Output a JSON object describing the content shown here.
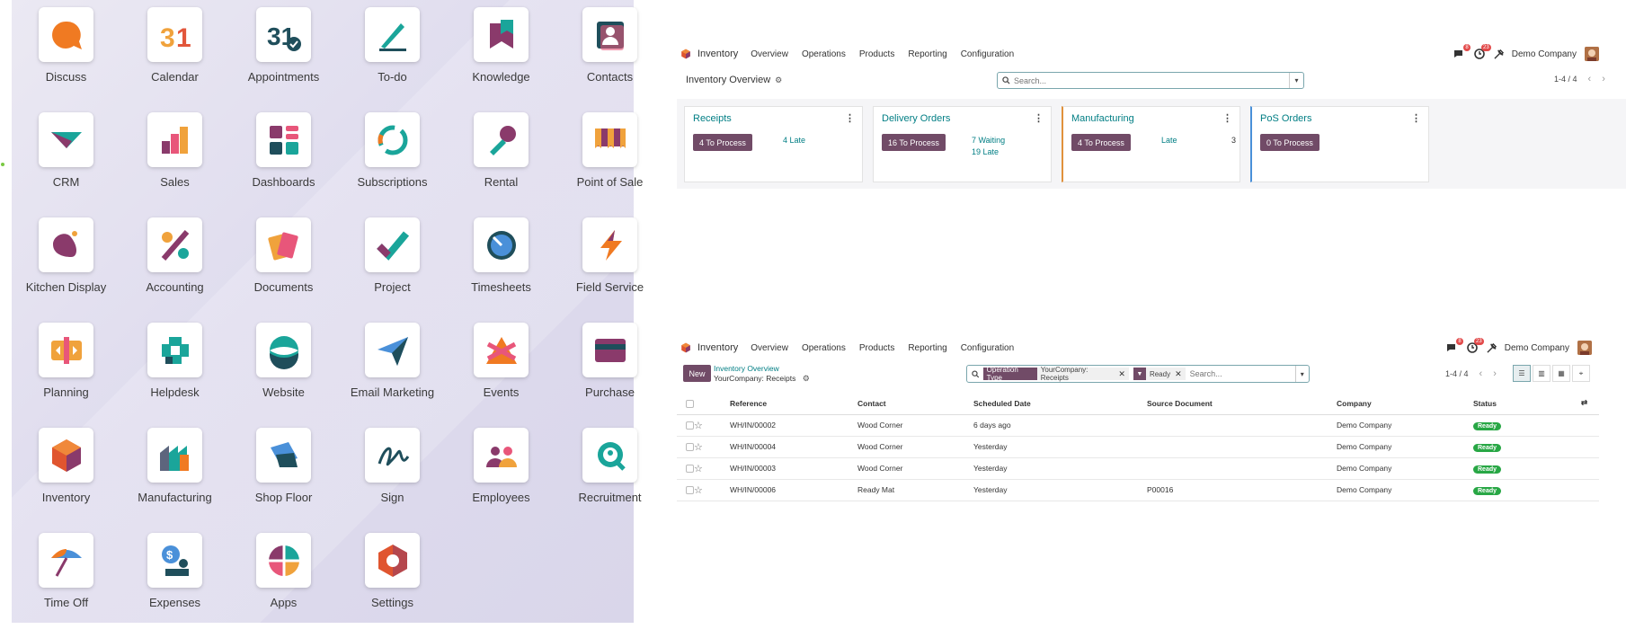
{
  "launcher": {
    "apps": [
      {
        "label": "Discuss",
        "icon": "discuss-icon"
      },
      {
        "label": "Calendar",
        "icon": "calendar-icon"
      },
      {
        "label": "Appointments",
        "icon": "appointments-icon"
      },
      {
        "label": "To-do",
        "icon": "todo-icon"
      },
      {
        "label": "Knowledge",
        "icon": "knowledge-icon"
      },
      {
        "label": "Contacts",
        "icon": "contacts-icon"
      },
      {
        "label": "CRM",
        "icon": "crm-icon"
      },
      {
        "label": "Sales",
        "icon": "sales-icon"
      },
      {
        "label": "Dashboards",
        "icon": "dashboards-icon"
      },
      {
        "label": "Subscriptions",
        "icon": "subscriptions-icon"
      },
      {
        "label": "Rental",
        "icon": "rental-icon"
      },
      {
        "label": "Point of Sale",
        "icon": "point-of-sale-icon"
      },
      {
        "label": "Kitchen Display",
        "icon": "kitchen-display-icon"
      },
      {
        "label": "Accounting",
        "icon": "accounting-icon"
      },
      {
        "label": "Documents",
        "icon": "documents-icon"
      },
      {
        "label": "Project",
        "icon": "project-icon"
      },
      {
        "label": "Timesheets",
        "icon": "timesheets-icon"
      },
      {
        "label": "Field Service",
        "icon": "field-service-icon"
      },
      {
        "label": "Planning",
        "icon": "planning-icon"
      },
      {
        "label": "Helpdesk",
        "icon": "helpdesk-icon"
      },
      {
        "label": "Website",
        "icon": "website-icon"
      },
      {
        "label": "Email Marketing",
        "icon": "email-marketing-icon"
      },
      {
        "label": "Events",
        "icon": "events-icon"
      },
      {
        "label": "Purchase",
        "icon": "purchase-icon"
      },
      {
        "label": "Inventory",
        "icon": "inventory-icon"
      },
      {
        "label": "Manufacturing",
        "icon": "manufacturing-icon"
      },
      {
        "label": "Shop Floor",
        "icon": "shop-floor-icon"
      },
      {
        "label": "Sign",
        "icon": "sign-icon"
      },
      {
        "label": "Employees",
        "icon": "employees-icon"
      },
      {
        "label": "Recruitment",
        "icon": "recruitment-icon"
      },
      {
        "label": "Time Off",
        "icon": "time-off-icon"
      },
      {
        "label": "Expenses",
        "icon": "expenses-icon"
      },
      {
        "label": "Apps",
        "icon": "apps-icon"
      },
      {
        "label": "Settings",
        "icon": "settings-icon"
      }
    ]
  },
  "topbar": {
    "app_name": "Inventory",
    "menu": [
      "Overview",
      "Operations",
      "Products",
      "Reporting",
      "Configuration"
    ],
    "messages_count": "8",
    "activities_count": "23",
    "company": "Demo Company"
  },
  "overview": {
    "title": "Inventory Overview",
    "search_placeholder": "Search...",
    "pager": "1-4 / 4",
    "cards": [
      {
        "title": "Receipts",
        "button": "4 To Process",
        "stats": [
          "4 Late"
        ],
        "accent": ""
      },
      {
        "title": "Delivery Orders",
        "button": "16 To Process",
        "stats": [
          "7 Waiting",
          "19 Late"
        ],
        "accent": ""
      },
      {
        "title": "Manufacturing",
        "button": "4 To Process",
        "stats": [
          "Late"
        ],
        "number": "3",
        "accent": "#e0913c"
      },
      {
        "title": "PoS Orders",
        "button": "0 To Process",
        "stats": [],
        "accent": "#4a90d9"
      }
    ]
  },
  "list": {
    "new_label": "New",
    "breadcrumb_parent": "Inventory Overview",
    "breadcrumb_current": "YourCompany: Receipts",
    "facets": [
      {
        "label": "Operation Type",
        "value": "YourCompany: Receipts"
      },
      {
        "label": "",
        "value": "Ready"
      }
    ],
    "search_placeholder": "Search...",
    "pager": "1-4 / 4",
    "columns": [
      "Reference",
      "Contact",
      "Scheduled Date",
      "Source Document",
      "Company",
      "Status"
    ],
    "rows": [
      {
        "reference": "WH/IN/00002",
        "contact": "Wood Corner",
        "date": "6 days ago",
        "source": "",
        "company": "Demo Company",
        "status": "Ready"
      },
      {
        "reference": "WH/IN/00004",
        "contact": "Wood Corner",
        "date": "Yesterday",
        "source": "",
        "company": "Demo Company",
        "status": "Ready"
      },
      {
        "reference": "WH/IN/00003",
        "contact": "Wood Corner",
        "date": "Yesterday",
        "source": "",
        "company": "Demo Company",
        "status": "Ready"
      },
      {
        "reference": "WH/IN/00006",
        "contact": "Ready Mat",
        "date": "Yesterday",
        "source": "P00016",
        "company": "Demo Company",
        "status": "Ready"
      }
    ]
  },
  "colors": {
    "brand_primary": "#714b67",
    "link_teal": "#017e84",
    "late_red": "#d23f3a",
    "ready_green": "#28a745"
  }
}
